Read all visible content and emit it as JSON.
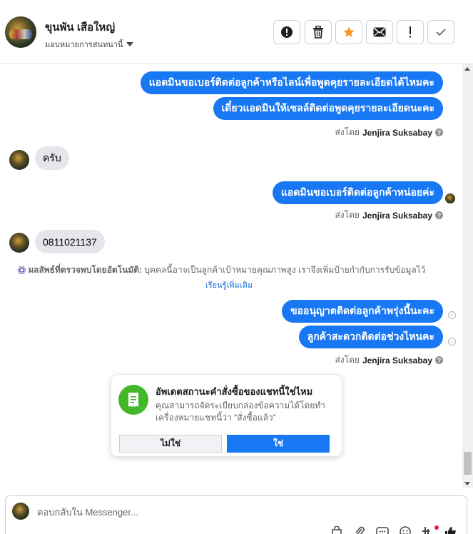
{
  "header": {
    "contact_name": "ขุนพัน เสือใหญ่",
    "assign_label": "มอบหมายการสนทนานี้",
    "tools": [
      {
        "name": "report-spam-button",
        "icon": "exclamation-circle-icon"
      },
      {
        "name": "delete-button",
        "icon": "trash-icon"
      },
      {
        "name": "star-button",
        "icon": "star-icon",
        "color": "#f7931e"
      },
      {
        "name": "mark-unread-button",
        "icon": "envelope-icon"
      },
      {
        "name": "follow-up-button",
        "icon": "exclamation-icon"
      },
      {
        "name": "mark-done-button",
        "icon": "checkmark-icon"
      }
    ]
  },
  "messages": {
    "m1": "แอดมินขอเบอร์ติดต่อลูกค้าหรือไลน์เพื่อพูดคุยรายละเอียดได้ไหมคะ",
    "m2": "เดี๋ยวแอดมินให้เซลล์ติดต่อพูดคุยรายละเอียดนะคะ",
    "sent_by_prefix": "ส่งโดย",
    "sender": "Jenjira Suksabay",
    "help": "?",
    "m3": "ครับ",
    "m4": "แอดมินขอเบอร์ติดต่อลูกค้าหน่อยค่ะ",
    "m5": "0811021137",
    "m6": "ขออนุญาตติดต่อลูกค้าพรุ่งนี้นะคะ",
    "m7": "ลูกค้าสะดวกติดต่อช่วงไหนคะ"
  },
  "ai_note": {
    "label": "ผลลัพธ์ที่ตรวจพบโดยอัตโนมัติ:",
    "text": "บุคคลนี้อาจเป็นลูกค้าเป้าหมายคุณภาพสูง เราจึงเพิ่มป้ายกำกับการรับข้อมูลไว้",
    "learn_more": "เรียนรู้เพิ่มเติม"
  },
  "order_card": {
    "title": "อัพเดตสถานะคำสั่งซื้อของแชทนี้ใช่ไหม",
    "desc": "คุณสามารถจัดระเบียบกล่องข้อความได้โดยทำเครื่องหมายแชทนี้ว่า \"สั่งซื้อแล้ว\"",
    "no_label": "ไม่ใช่",
    "yes_label": "ใช่",
    "icon": "receipt-icon"
  },
  "composer": {
    "placeholder": "ตอบกลับใน Messenger..."
  },
  "colors": {
    "accent": "#1877f2",
    "incoming_bubble": "#e4e6eb",
    "card_icon": "#42b72a"
  }
}
